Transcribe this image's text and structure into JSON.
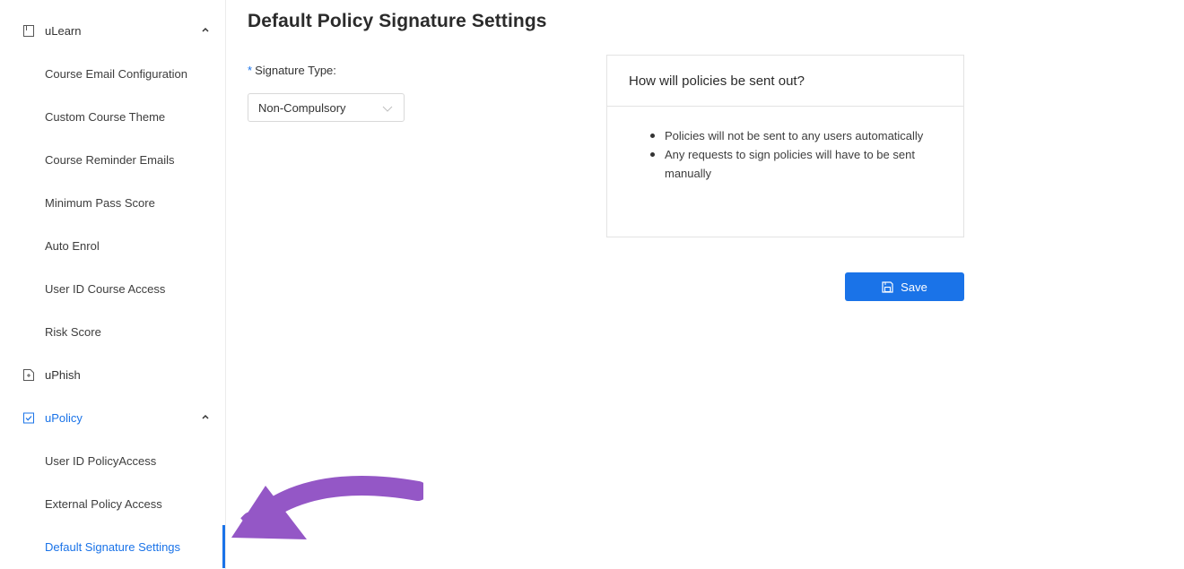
{
  "page": {
    "title": "Default Policy Signature Settings"
  },
  "sidebar": {
    "groups": [
      {
        "label": "uLearn",
        "icon": "book-icon"
      },
      {
        "label": "uPhish",
        "icon": "file-icon"
      },
      {
        "label": "uPolicy",
        "icon": "checkbox-icon"
      }
    ],
    "ulearn_items": [
      "Course Email Configuration",
      "Custom Course Theme",
      "Course Reminder Emails",
      "Minimum Pass Score",
      "Auto Enrol",
      "User ID Course Access",
      "Risk Score"
    ],
    "upolicy_items": [
      "User ID PolicyAccess",
      "External Policy Access",
      "Default Signature Settings"
    ]
  },
  "form": {
    "required_mark": "*",
    "label": "Signature Type",
    "label_colon": ":",
    "selected_value": "Non-Compulsory"
  },
  "panel": {
    "title": "How will policies be sent out?",
    "bullets": [
      "Policies will not be sent to any users automatically",
      "Any requests to sign policies will have to be sent manually"
    ]
  },
  "actions": {
    "save_label": "Save"
  },
  "colors": {
    "accent": "#1a73e8",
    "annotation_arrow": "#9457c6"
  }
}
